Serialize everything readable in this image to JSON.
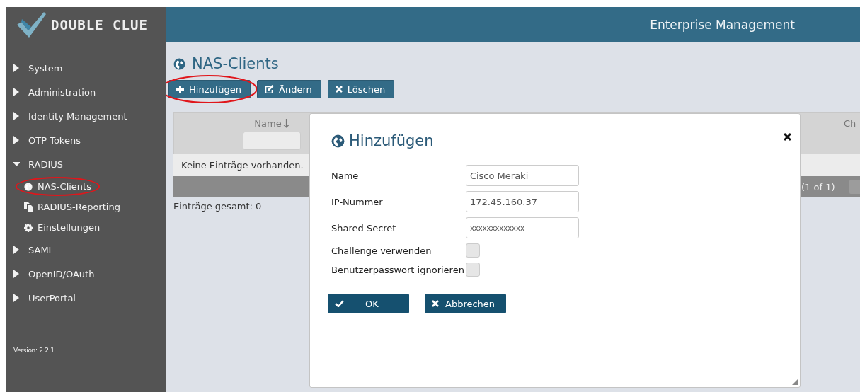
{
  "logo": {
    "text": "DOUBLE CLUE"
  },
  "header": {
    "title": "Enterprise Management"
  },
  "sidebar": {
    "items": [
      {
        "label": "System",
        "expanded": false
      },
      {
        "label": "Administration",
        "expanded": false
      },
      {
        "label": "Identity Management",
        "expanded": false
      },
      {
        "label": "OTP Tokens",
        "expanded": false
      },
      {
        "label": "RADIUS",
        "expanded": true,
        "children": [
          {
            "label": "NAS-Clients",
            "highlighted": true
          },
          {
            "label": "RADIUS-Reporting",
            "highlighted": false
          },
          {
            "label": "Einstellungen",
            "highlighted": false
          }
        ]
      },
      {
        "label": "SAML",
        "expanded": false
      },
      {
        "label": "OpenID/OAuth",
        "expanded": false
      },
      {
        "label": "UserPortal",
        "expanded": false
      }
    ],
    "version": "Version: 2.2.1"
  },
  "page": {
    "title": "NAS-Clients",
    "toolbar": [
      {
        "label": "Hinzufügen",
        "highlighted": true
      },
      {
        "label": "Ändern",
        "highlighted": false
      },
      {
        "label": "Löschen",
        "highlighted": false
      }
    ],
    "table": {
      "columns": [
        {
          "label": "Name"
        },
        {
          "label": "Ch"
        }
      ],
      "empty_message": "Keine Einträge vorhanden.",
      "pager": "(1 of 1)",
      "total": "Einträge gesamt: 0"
    }
  },
  "dialog": {
    "title": "Hinzufügen",
    "fields": [
      {
        "kind": "text",
        "label": "Name",
        "value": "Cisco Meraki"
      },
      {
        "kind": "text",
        "label": "IP-Nummer",
        "value": "172.45.160.37"
      },
      {
        "kind": "secret",
        "label": "Shared Secret",
        "value": "xxxxxxxxxxxxx"
      },
      {
        "kind": "checkbox",
        "label": "Challenge verwenden",
        "checked": false
      },
      {
        "kind": "checkbox",
        "label": "Benutzerpasswort ignorieren",
        "checked": false
      }
    ],
    "buttons": [
      {
        "label": "OK"
      },
      {
        "label": "Abbrechen"
      }
    ]
  }
}
